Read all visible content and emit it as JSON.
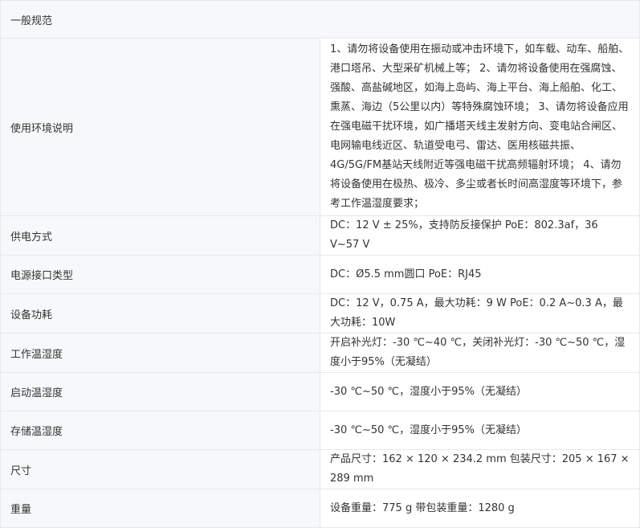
{
  "section_title": "一般规范",
  "rows": [
    {
      "label": "使用环境说明",
      "value": "1、请勿将设备使用在振动或冲击环境下，如车载、动车、船舶、港口塔吊、大型采矿机械上等； 2、请勿将设备使用在强腐蚀、强酸、高盐碱地区，如海上岛屿、海上平台、海上船舶、化工、熏蒸、海边（5公里以内）等特殊腐蚀环境； 3、请勿将设备应用在强电磁干扰环境，如广播塔天线主发射方向、变电站合闸区、电网输电线近区、轨道受电弓、雷达、医用核磁共振、4G/5G/FM基站天线附近等强电磁干扰高频辐射环境； 4、请勿将设备使用在极热、极冷、多尘或者长时间高湿度等环境下，参考工作温湿度要求；"
    },
    {
      "label": "供电方式",
      "value": "DC：12 V ± 25%，支持防反接保护 PoE：802.3af，36 V~57 V"
    },
    {
      "label": "电源接口类型",
      "value": "DC：Ø5.5 mm圆口 PoE：RJ45"
    },
    {
      "label": "设备功耗",
      "value": "DC：12 V，0.75 A，最大功耗：9 W PoE：0.2 A~0.3 A，最大功耗：10W"
    },
    {
      "label": "工作温湿度",
      "value": "开启补光灯：-30 ℃~40 ℃，关闭补光灯：-30 ℃~50 ℃，湿度小于95%（无凝结）"
    },
    {
      "label": "启动温湿度",
      "value": "-30 ℃~50 ℃，湿度小于95%（无凝结）"
    },
    {
      "label": "存储温湿度",
      "value": "-30 ℃~50 ℃，湿度小于95%（无凝结）"
    },
    {
      "label": "尺寸",
      "value": "产品尺寸：162 × 120 × 234.2 mm 包装尺寸：205 × 167 × 289 mm"
    },
    {
      "label": "重量",
      "value": "设备重量：775 g 带包装重量：1280 g"
    }
  ],
  "colors": {
    "header_bg": "#f7f8fa",
    "border": "#e8e8e8",
    "text": "#333333"
  }
}
